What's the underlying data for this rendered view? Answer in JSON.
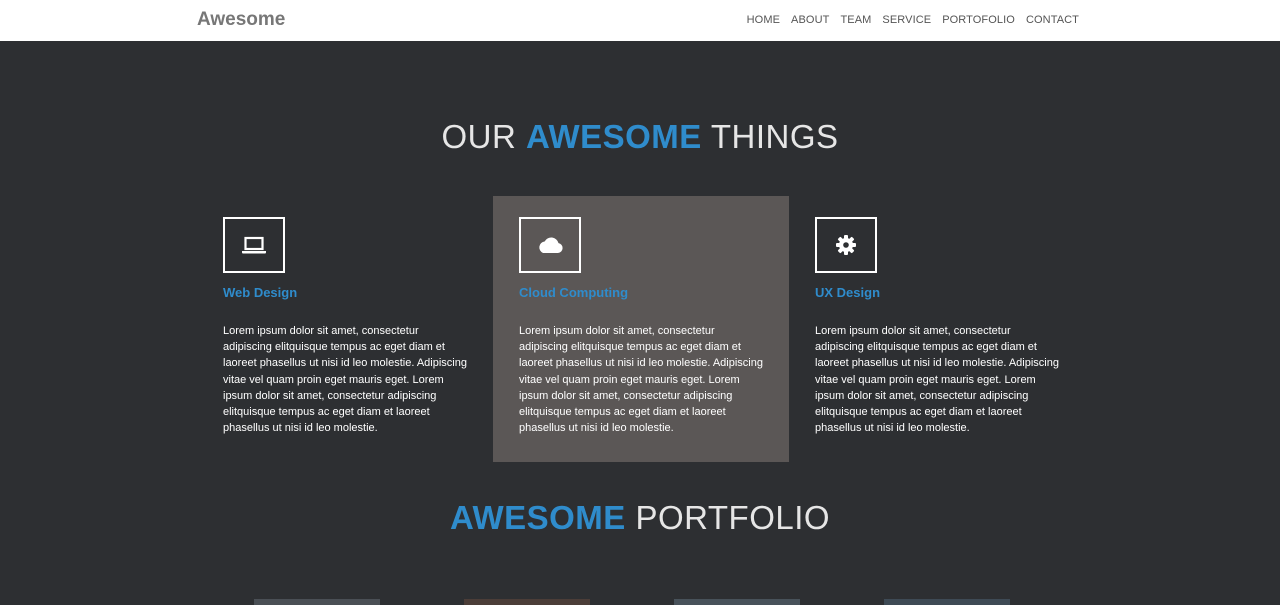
{
  "navbar": {
    "brand": "Awesome",
    "links": [
      "HOME",
      "ABOUT",
      "TEAM",
      "SERVICE",
      "PORTOFOLIO",
      "CONTACT"
    ]
  },
  "features": {
    "title_pre": "OUR ",
    "title_accent": "AWESOME",
    "title_post": " THINGS",
    "cards": [
      {
        "icon": "laptop-icon",
        "heading": "Web Design",
        "text": "Lorem ipsum dolor sit amet, consectetur adipiscing elitquisque tempus ac eget diam et laoreet phasellus ut nisi id leo molestie. Adipiscing vitae vel quam proin eget mauris eget. Lorem ipsum dolor sit amet, consectetur adipiscing elitquisque tempus ac eget diam et laoreet phasellus ut nisi id leo molestie."
      },
      {
        "icon": "cloud-icon",
        "heading": "Cloud Computing",
        "text": "Lorem ipsum dolor sit amet, consectetur adipiscing elitquisque tempus ac eget diam et laoreet phasellus ut nisi id leo molestie. Adipiscing vitae vel quam proin eget mauris eget. Lorem ipsum dolor sit amet, consectetur adipiscing elitquisque tempus ac eget diam et laoreet phasellus ut nisi id leo molestie."
      },
      {
        "icon": "gear-icon",
        "heading": "UX Design",
        "text": "Lorem ipsum dolor sit amet, consectetur adipiscing elitquisque tempus ac eget diam et laoreet phasellus ut nisi id leo molestie. Adipiscing vitae vel quam proin eget mauris eget. Lorem ipsum dolor sit amet, consectetur adipiscing elitquisque tempus ac eget diam et laoreet phasellus ut nisi id leo molestie."
      }
    ]
  },
  "portfolio": {
    "title_accent": "AWESOME",
    "title_post": " PORTFOLIO"
  },
  "colors": {
    "accent": "#2f8ccc",
    "background": "#2d2f32",
    "active_card": "#5b5756"
  }
}
